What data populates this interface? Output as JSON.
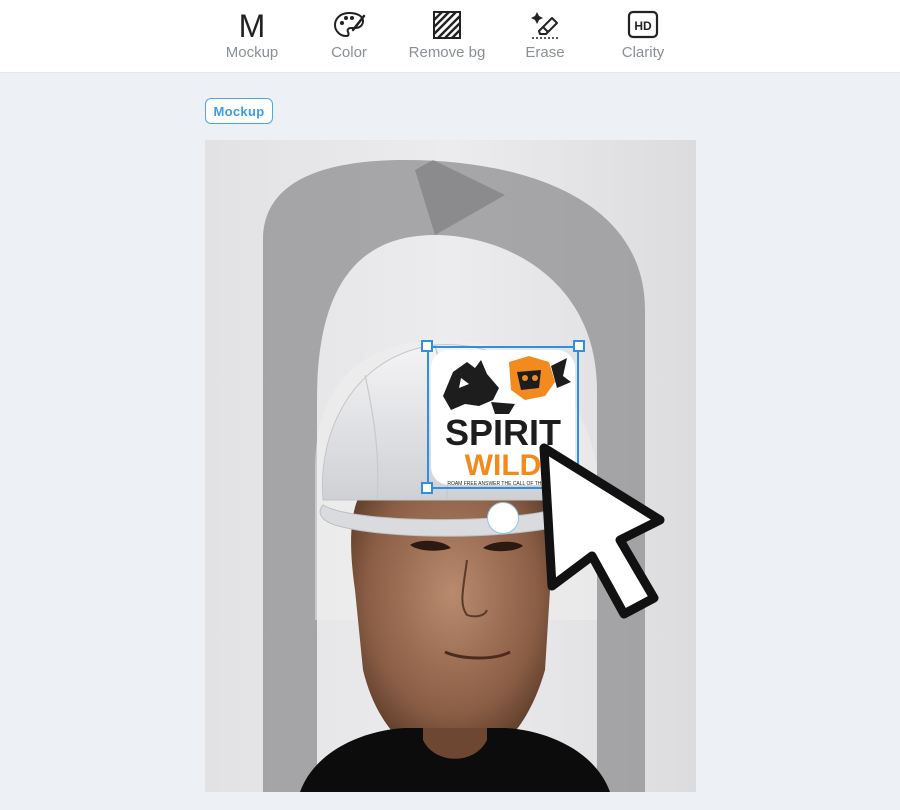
{
  "toolbar": {
    "tools": [
      {
        "label": "Mockup",
        "icon": "mockup-m-icon",
        "glyph": "M"
      },
      {
        "label": "Color",
        "icon": "palette-icon"
      },
      {
        "label": "Remove bg",
        "icon": "remove-bg-icon"
      },
      {
        "label": "Erase",
        "icon": "eraser-icon"
      },
      {
        "label": "Clarity",
        "icon": "hd-icon",
        "glyph": "HD"
      }
    ]
  },
  "canvas": {
    "tag": "Mockup",
    "design": {
      "title_line1": "SPIRIT",
      "title_line2": "WILD",
      "tagline": "ROAM FREE ANSWER THE CALL OF THE WILD"
    }
  },
  "colors": {
    "accent": "#2f8fe0",
    "design_orange": "#f28a1e",
    "toolbar_text": "#8a8f96",
    "page_bg": "#edf1f5"
  }
}
